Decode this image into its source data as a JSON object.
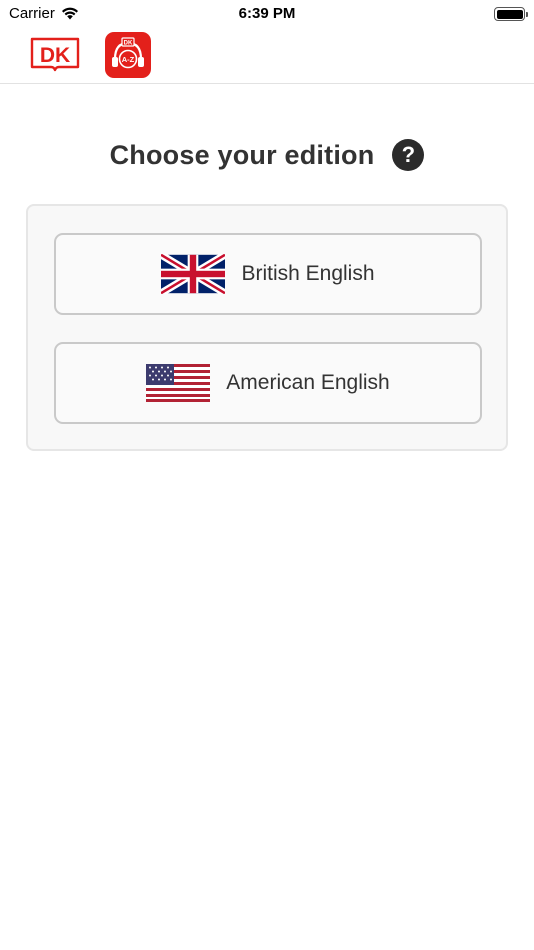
{
  "status_bar": {
    "carrier": "Carrier",
    "time": "6:39 PM"
  },
  "header": {
    "logo_text": "DK",
    "app_icon_top_text": "DK",
    "app_icon_text": "A-Z"
  },
  "main": {
    "title": "Choose your edition",
    "help_symbol": "?",
    "editions": [
      {
        "label": "British English",
        "flag": "uk-flag-icon"
      },
      {
        "label": "American English",
        "flag": "us-flag-icon"
      }
    ]
  },
  "colors": {
    "brand_red": "#e3201b",
    "title_text": "#333333",
    "card_bg": "#f8f8f8",
    "button_border": "#c9c9c9"
  }
}
